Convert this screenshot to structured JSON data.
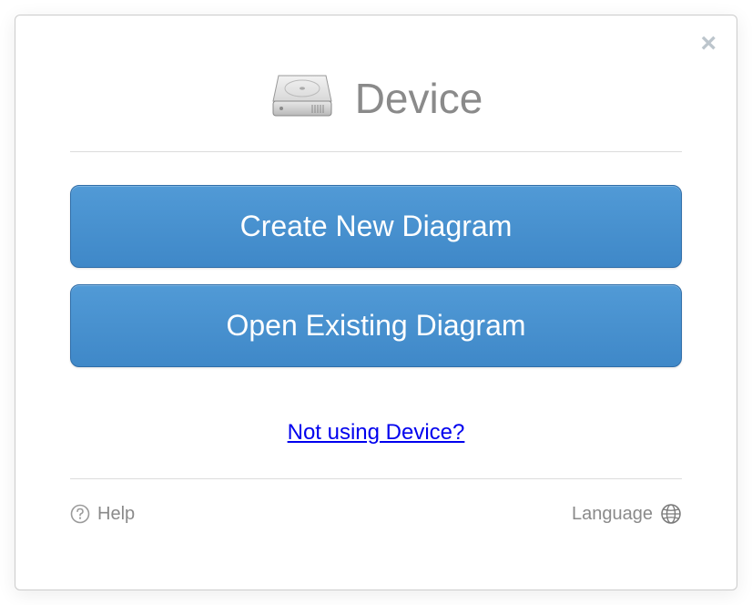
{
  "title": "Device",
  "buttons": {
    "create": "Create New Diagram",
    "open": "Open Existing Diagram"
  },
  "storageLink": "Not using Device?",
  "footer": {
    "help": "Help",
    "language": "Language"
  }
}
